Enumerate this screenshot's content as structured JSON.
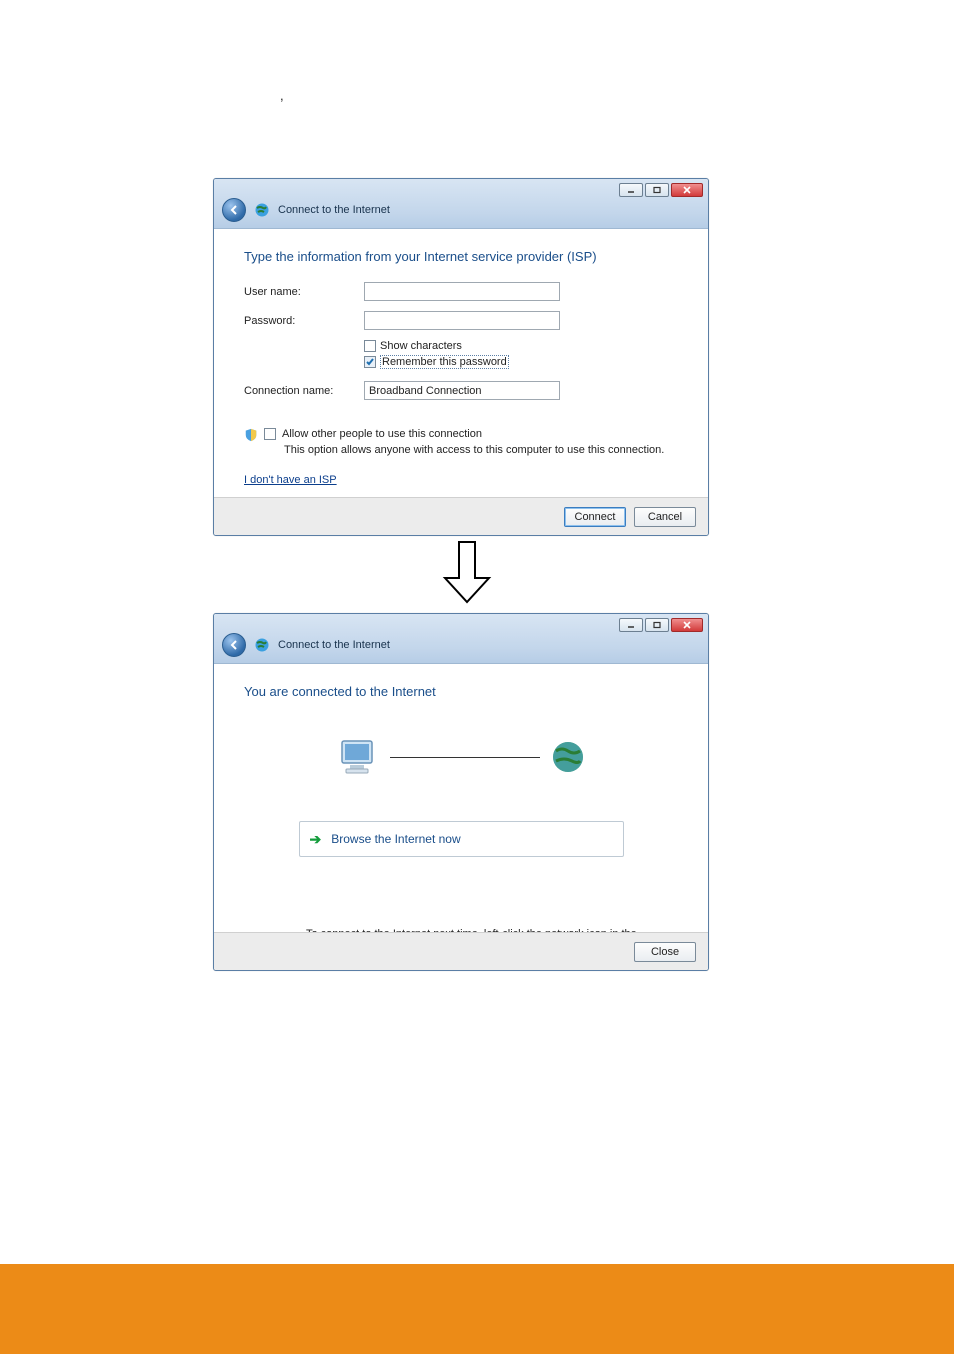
{
  "punct": ",",
  "window1": {
    "title": "Connect to the Internet",
    "heading": "Type the information from your Internet service provider (ISP)",
    "labels": {
      "username": "User name:",
      "password": "Password:",
      "connection_name": "Connection name:"
    },
    "fields": {
      "username": "",
      "password": "",
      "connection_name": "Broadband Connection"
    },
    "checkboxes": {
      "show_chars": {
        "label": "Show characters",
        "checked": false
      },
      "remember": {
        "label": "Remember this password",
        "checked": true
      },
      "allow_others": {
        "label": "Allow other people to use this connection",
        "checked": false
      }
    },
    "allow_help": "This option allows anyone with access to this computer to use this connection.",
    "link": "I don't have an ISP",
    "buttons": {
      "connect": "Connect",
      "cancel": "Cancel"
    }
  },
  "window2": {
    "title": "Connect to the Internet",
    "heading": "You are connected to the Internet",
    "command": "Browse the Internet now",
    "note": "To connect to the Internet next time, left-click the network icon in the taskbar and click the connection you just created.",
    "buttons": {
      "close": "Close"
    }
  },
  "colors": {
    "accent_blue": "#1a4e8a",
    "footer_orange": "#ec8b17"
  }
}
